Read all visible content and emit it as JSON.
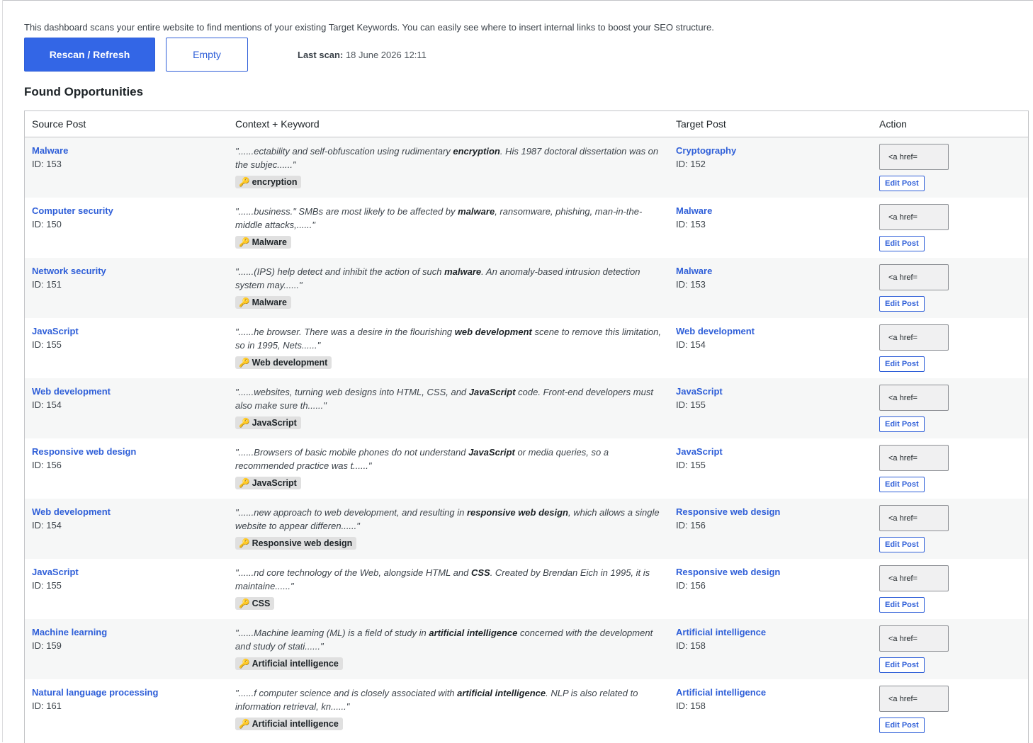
{
  "description": "This dashboard scans your entire website to find mentions of your existing Target Keywords. You can easily see where to insert internal links to boost your SEO structure.",
  "buttons": {
    "rescan": "Rescan / Refresh",
    "empty": "Empty"
  },
  "last_scan": {
    "label": "Last scan:",
    "value": "18 June 2026 12:11"
  },
  "section_title": "Found Opportunities",
  "table": {
    "headers": [
      "Source Post",
      "Context + Keyword",
      "Target Post",
      "Action"
    ],
    "code_preview": "<a href=",
    "edit_label": "Edit Post",
    "key_icon": "🔑",
    "rows": [
      {
        "source": {
          "title": "Malware",
          "id": "ID: 153"
        },
        "context": {
          "before": "\"......ectability and self-obfuscation using rudimentary ",
          "keyword": "encryption",
          "after": ". His 1987 doctoral dissertation was on the subjec......\""
        },
        "badge": "encryption",
        "target": {
          "title": "Cryptography",
          "id": "ID: 152"
        }
      },
      {
        "source": {
          "title": "Computer security",
          "id": "ID: 150"
        },
        "context": {
          "before": "\"......business.\" SMBs are most likely to be affected by ",
          "keyword": "malware",
          "after": ", ransomware, phishing, man-in-the-middle attacks,......\""
        },
        "badge": "Malware",
        "target": {
          "title": "Malware",
          "id": "ID: 153"
        }
      },
      {
        "source": {
          "title": "Network security",
          "id": "ID: 151"
        },
        "context": {
          "before": "\"......(IPS) help detect and inhibit the action of such ",
          "keyword": "malware",
          "after": ". An anomaly-based intrusion detection system may......\""
        },
        "badge": "Malware",
        "target": {
          "title": "Malware",
          "id": "ID: 153"
        }
      },
      {
        "source": {
          "title": "JavaScript",
          "id": "ID: 155"
        },
        "context": {
          "before": "\"......he browser. There was a desire in the flourishing ",
          "keyword": "web development",
          "after": " scene to remove this limitation, so in 1995, Nets......\""
        },
        "badge": "Web development",
        "target": {
          "title": "Web development",
          "id": "ID: 154"
        }
      },
      {
        "source": {
          "title": "Web development",
          "id": "ID: 154"
        },
        "context": {
          "before": "\"......websites, turning web designs into HTML, CSS, and ",
          "keyword": "JavaScript",
          "after": " code. Front-end developers must also make sure th......\""
        },
        "badge": "JavaScript",
        "target": {
          "title": "JavaScript",
          "id": "ID: 155"
        }
      },
      {
        "source": {
          "title": "Responsive web design",
          "id": "ID: 156"
        },
        "context": {
          "before": "\"......Browsers of basic mobile phones do not understand ",
          "keyword": "JavaScript",
          "after": " or media queries, so a recommended practice was t......\""
        },
        "badge": "JavaScript",
        "target": {
          "title": "JavaScript",
          "id": "ID: 155"
        }
      },
      {
        "source": {
          "title": "Web development",
          "id": "ID: 154"
        },
        "context": {
          "before": "\"......new approach to web development, and resulting in ",
          "keyword": "responsive web design",
          "after": ", which allows a single website to appear differen......\""
        },
        "badge": "Responsive web design",
        "target": {
          "title": "Responsive web design",
          "id": "ID: 156"
        }
      },
      {
        "source": {
          "title": "JavaScript",
          "id": "ID: 155"
        },
        "context": {
          "before": "\"......nd core technology of the Web, alongside HTML and ",
          "keyword": "CSS",
          "after": ". Created by Brendan Eich in 1995, it is maintaine......\""
        },
        "badge": "CSS",
        "target": {
          "title": "Responsive web design",
          "id": "ID: 156"
        }
      },
      {
        "source": {
          "title": "Machine learning",
          "id": "ID: 159"
        },
        "context": {
          "before": "\"......Machine learning (ML) is a field of study in ",
          "keyword": "artificial intelligence",
          "after": " concerned with the development and study of stati......\""
        },
        "badge": "Artificial intelligence",
        "target": {
          "title": "Artificial intelligence",
          "id": "ID: 158"
        }
      },
      {
        "source": {
          "title": "Natural language processing",
          "id": "ID: 161"
        },
        "context": {
          "before": "\"......f computer science and is closely associated with ",
          "keyword": "artificial intelligence",
          "after": ". NLP is also related to information retrieval, kn......\""
        },
        "badge": "Artificial intelligence",
        "target": {
          "title": "Artificial intelligence",
          "id": "ID: 158"
        }
      }
    ]
  }
}
